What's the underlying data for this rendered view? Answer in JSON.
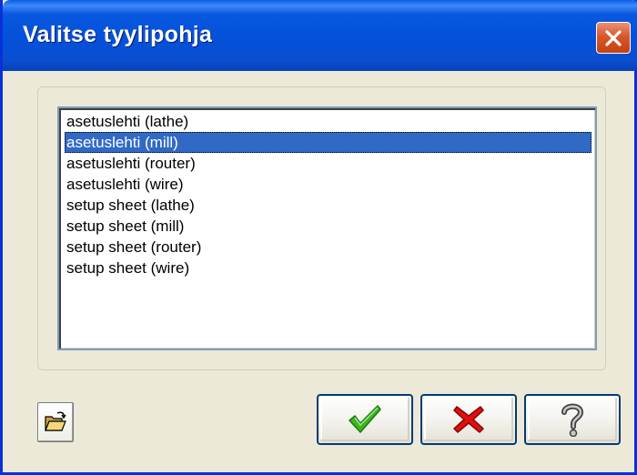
{
  "dialog": {
    "title": "Valitse tyylipohja"
  },
  "list": {
    "items": [
      "asetuslehti (lathe)",
      "asetuslehti (mill)",
      "asetuslehti (router)",
      "asetuslehti (wire)",
      "setup sheet (lathe)",
      "setup sheet (mill)",
      "setup sheet (router)",
      "setup sheet (wire)"
    ],
    "selected_index": 1
  },
  "buttons": {
    "open_icon": "folder-open-icon",
    "ok_icon": "checkmark-icon",
    "cancel_icon": "red-x-icon",
    "help_icon": "question-mark-icon",
    "close_icon": "close-icon"
  },
  "colors": {
    "titlebar": "#0550d8",
    "selection": "#316ac5",
    "ok_green": "#3cb521",
    "cancel_red": "#e01010",
    "close_red": "#d9572b"
  }
}
